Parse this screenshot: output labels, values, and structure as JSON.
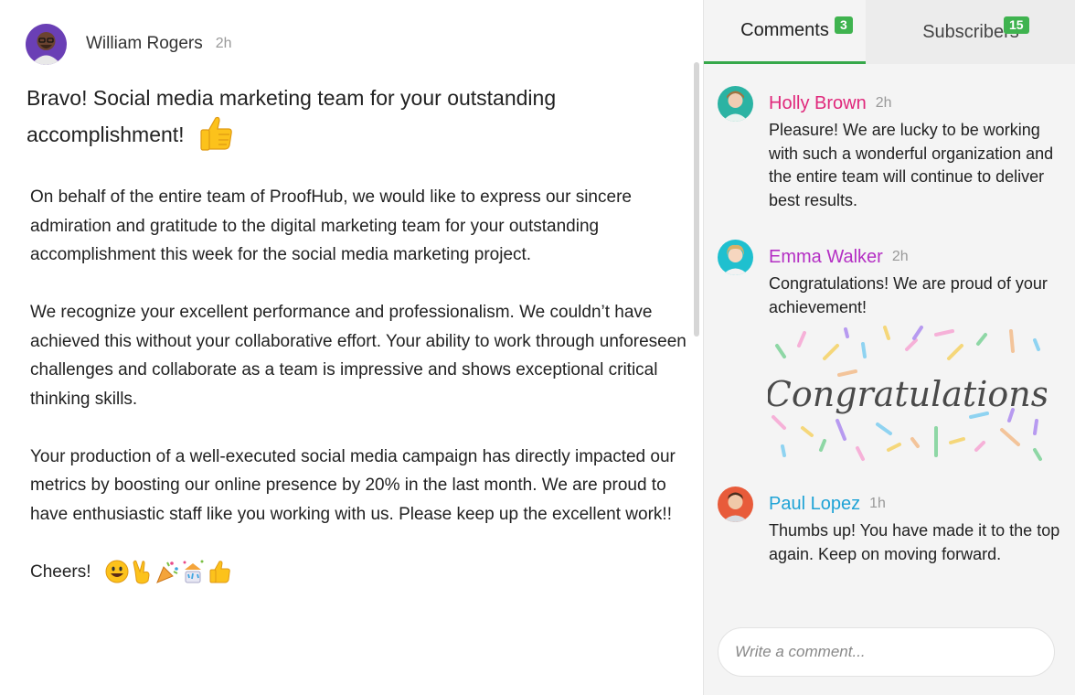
{
  "post": {
    "author": "William Rogers",
    "time": "2h",
    "title": "Bravo! Social media marketing team for your outstanding accomplishment!",
    "paragraphs": [
      "On behalf of the entire team of ProofHub, we would like to express our sincere admiration and gratitude to the digital marketing team for your outstanding accomplishment this week for the social media marketing project.",
      "We recognize your excellent performance and professionalism. We couldn’t have achieved this without your collaborative effort. Your ability to work through unforeseen challenges and collaborate as a team is impressive and shows exceptional critical thinking skills.",
      "Your production of a well-executed social media campaign has directly impacted our metrics by boosting our online presence by 20% in the last month. We are proud to have enthusiastic staff like you working with us. Please keep up the excellent work!!"
    ],
    "signoff": "Cheers!",
    "emojis": [
      "grinning-face-icon",
      "victory-hand-icon",
      "party-popper-icon",
      "confetti-icon",
      "thumbs-up-icon"
    ]
  },
  "tabs": {
    "comments": {
      "label": "Comments",
      "count": "3"
    },
    "subscribers": {
      "label": "Subscribers",
      "count": "15"
    }
  },
  "comments": [
    {
      "name": "Holly Brown",
      "name_color": "#e0287b",
      "time": "2h",
      "text": "Pleasure! We are lucky to be working with such a wonderful organization and the entire team will continue to deliver best results."
    },
    {
      "name": "Emma Walker",
      "name_color": "#b42fc4",
      "time": "2h",
      "text": "Congratulations! We are proud of your achievement!",
      "image_text": "Congratulations"
    },
    {
      "name": "Paul Lopez",
      "name_color": "#1fa3d6",
      "time": "1h",
      "text": "Thumbs up! You have made it to the top again. Keep on moving forward."
    }
  ],
  "input": {
    "placeholder": "Write a comment..."
  },
  "colors": {
    "accent": "#36a84a",
    "badge": "#3fb34f"
  }
}
